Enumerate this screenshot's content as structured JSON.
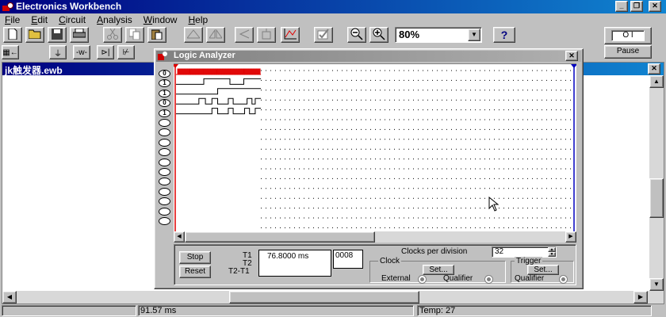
{
  "window": {
    "title": "Electronics Workbench",
    "minimize": "_",
    "restore": "❐",
    "close": "✕"
  },
  "menu": [
    "File",
    "Edit",
    "Circuit",
    "Analysis",
    "Window",
    "Help"
  ],
  "menu_accel": [
    "F",
    "E",
    "C",
    "A",
    "W",
    "H"
  ],
  "toolbar": {
    "zoom_value": "80%",
    "help_label": "?",
    "pause_label": "Pause",
    "power_label": "O I"
  },
  "document": {
    "title": "jk触发器.ewb"
  },
  "logic_analyzer": {
    "title": "Logic Analyzer",
    "close_label": "✕",
    "cursor_t1_marker": "1",
    "cursor_t2_marker": "2",
    "channel_labels": [
      "0",
      "1",
      "1",
      "0",
      "1",
      "",
      "",
      "",
      "",
      "",
      "",
      "",
      "",
      "",
      "",
      ""
    ],
    "stop_label": "Stop",
    "reset_label": "Reset",
    "t1_label": "T1",
    "t2_label": "T2",
    "t2t1_label": "T2-T1",
    "t1_value": "76.8000 ms",
    "hex_value": "0008",
    "clocks_per_division_label": "Clocks per division",
    "clocks_per_division_value": "32",
    "clock_label": "Clock",
    "trigger_label": "Trigger",
    "clock_set_label": "Set...",
    "trigger_set_label": "Set...",
    "external_label": "External",
    "clock_qualifier_label": "Qualifier",
    "trigger_qualifier_label": "Qualifier",
    "waveforms": [
      {
        "color": "#e00000",
        "steps": [
          0,
          0,
          1,
          0,
          1,
          0,
          1,
          0,
          1,
          0,
          1,
          0,
          1,
          0,
          1,
          0,
          1,
          0,
          1,
          0,
          1,
          0,
          1,
          0,
          1,
          0,
          1,
          0,
          1,
          0,
          1,
          0,
          1,
          0,
          1,
          0,
          1,
          0,
          1,
          0,
          1,
          0,
          1,
          0,
          1,
          0,
          1,
          0,
          1,
          0,
          1,
          0,
          1,
          0,
          1,
          0,
          1,
          0,
          1,
          0,
          1,
          0,
          1,
          0,
          1,
          0,
          1,
          0,
          1,
          0,
          1,
          0,
          1,
          0,
          1,
          0,
          1,
          0,
          1,
          0,
          1,
          0,
          1,
          0,
          1,
          0,
          1,
          0,
          1,
          0,
          1,
          0,
          1,
          0,
          1,
          0,
          1,
          0,
          1,
          0,
          1,
          0,
          1,
          0
        ]
      },
      {
        "color": "#000000",
        "steps": [
          0,
          0,
          0,
          0,
          0,
          0,
          0,
          0,
          0,
          0,
          0,
          0,
          0,
          0,
          0,
          0,
          0,
          0,
          0,
          0,
          0,
          0,
          0,
          0,
          0,
          0,
          0,
          0,
          0,
          0,
          0,
          0,
          0,
          0,
          1,
          1,
          1,
          1,
          1,
          1,
          1,
          1,
          1,
          1,
          1,
          1,
          1,
          1,
          1,
          1,
          1,
          1,
          1,
          1,
          1,
          1,
          1,
          1,
          1,
          1,
          1,
          1,
          1,
          1,
          1,
          1,
          0,
          0,
          0,
          0,
          0,
          0,
          0,
          0,
          0,
          0,
          0,
          0,
          0,
          0,
          0,
          0,
          0,
          1,
          1,
          1,
          1,
          1,
          1,
          1,
          1,
          1,
          1,
          1,
          1,
          1,
          1,
          1,
          1,
          1,
          1,
          1,
          1,
          1
        ]
      },
      {
        "color": "#000000",
        "steps": [
          0,
          0,
          0,
          0,
          0,
          0,
          0,
          0,
          0,
          0,
          0,
          0,
          0,
          0,
          0,
          0,
          0,
          0,
          0,
          0,
          0,
          0,
          0,
          0,
          0,
          0,
          0,
          0,
          0,
          0,
          0,
          0,
          0,
          0,
          0,
          0,
          0,
          0,
          0,
          0,
          0,
          0,
          0,
          0,
          0,
          0,
          0,
          0,
          0,
          0,
          0,
          1,
          1,
          1,
          1,
          1,
          1,
          1,
          1,
          1,
          1,
          1,
          1,
          1,
          1,
          1,
          1,
          1,
          1,
          1,
          1,
          1,
          1,
          1,
          1,
          1,
          1,
          1,
          1,
          1,
          1,
          1,
          1,
          1,
          1,
          1,
          1,
          1,
          1,
          1,
          1,
          1,
          1,
          1,
          1,
          1,
          1,
          1,
          1,
          1,
          1,
          1,
          1,
          1
        ]
      },
      {
        "color": "#000000",
        "steps": [
          0,
          0,
          0,
          0,
          0,
          0,
          0,
          0,
          0,
          0,
          0,
          0,
          0,
          0,
          0,
          0,
          0,
          0,
          0,
          0,
          0,
          0,
          0,
          0,
          0,
          0,
          0,
          0,
          1,
          1,
          1,
          1,
          1,
          1,
          1,
          1,
          0,
          0,
          0,
          0,
          0,
          0,
          0,
          0,
          1,
          1,
          1,
          1,
          1,
          1,
          1,
          0,
          0,
          0,
          0,
          0,
          0,
          0,
          0,
          0,
          0,
          0,
          0,
          0,
          1,
          1,
          1,
          1,
          1,
          1,
          0,
          0,
          0,
          0,
          0,
          0,
          0,
          0,
          0,
          0,
          0,
          0,
          0,
          0,
          0,
          0,
          0,
          1,
          1,
          1,
          1,
          1,
          1,
          0,
          0,
          0,
          0,
          1,
          1,
          1,
          1,
          1,
          1,
          1
        ]
      },
      {
        "color": "#000000",
        "steps": [
          0,
          0,
          0,
          0,
          0,
          0,
          0,
          0,
          0,
          0,
          0,
          0,
          0,
          0,
          0,
          0,
          0,
          0,
          0,
          0,
          0,
          0,
          0,
          0,
          0,
          0,
          0,
          0,
          0,
          0,
          0,
          0,
          0,
          0,
          0,
          0,
          0,
          0,
          0,
          0,
          0,
          0,
          0,
          0,
          1,
          1,
          1,
          1,
          1,
          1,
          1,
          0,
          0,
          0,
          0,
          0,
          0,
          0,
          0,
          0,
          0,
          0,
          0,
          0,
          1,
          1,
          1,
          1,
          1,
          1,
          0,
          0,
          0,
          0,
          0,
          0,
          0,
          0,
          0,
          0,
          0,
          0,
          0,
          0,
          1,
          1,
          1,
          1,
          1,
          1,
          0,
          0,
          0,
          0,
          0,
          0,
          0,
          1,
          1,
          1,
          1,
          1,
          1,
          1
        ]
      }
    ]
  },
  "statusbar": {
    "sim_time": "91.57 ms",
    "temp": "Temp:  27"
  },
  "colors": {
    "title_start": "#000080",
    "title_end": "#1084d0",
    "grid_dot": "#000000",
    "cursor_t1": "#e00000",
    "cursor_t2": "#0000c0"
  }
}
